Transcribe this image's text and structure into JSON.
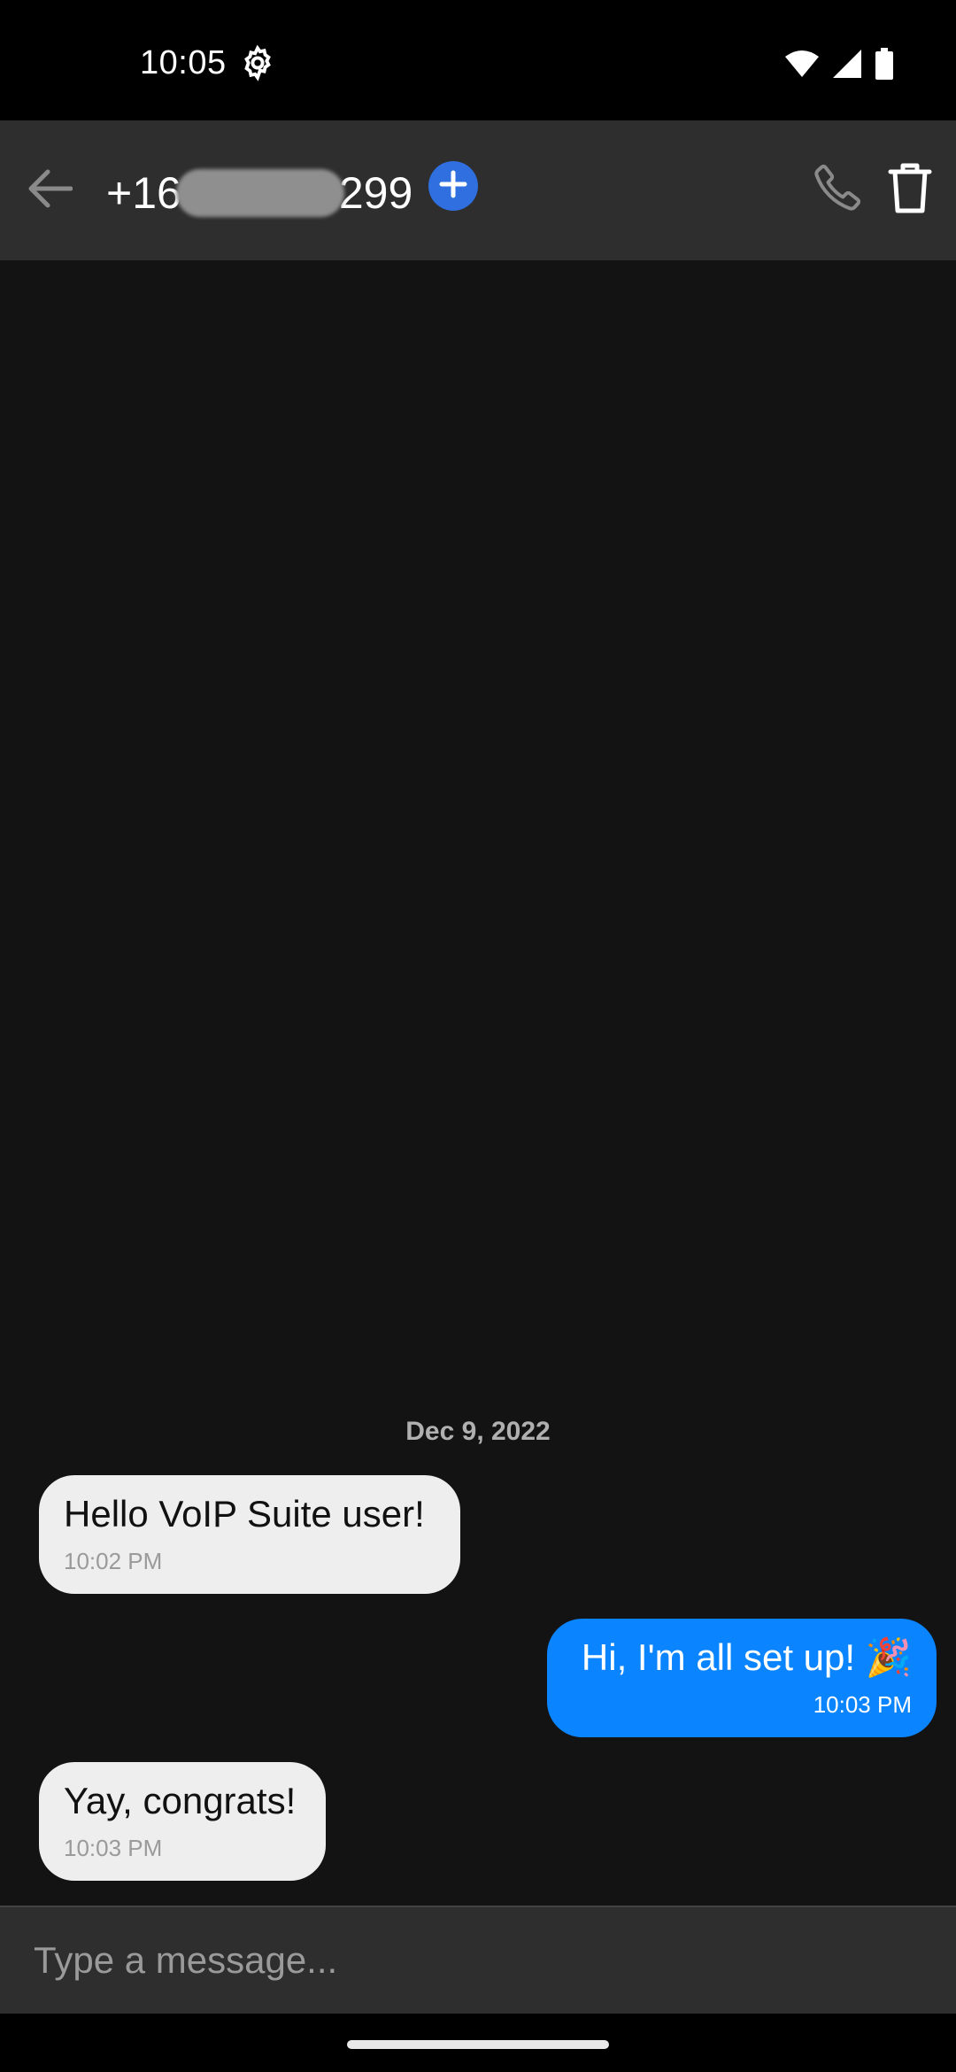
{
  "status_bar": {
    "time": "10:05",
    "icons": [
      "gear-icon",
      "wifi-icon",
      "cellular-signal-icon",
      "battery-icon"
    ]
  },
  "header": {
    "number_prefix": "+16",
    "number_suffix": "299",
    "icons": [
      "back-arrow-icon",
      "plus-icon",
      "phone-icon",
      "trash-icon"
    ]
  },
  "conversation": {
    "date_divider": "Dec 9, 2022",
    "messages": [
      {
        "direction": "incoming",
        "text": "Hello VoIP Suite user!",
        "time": "10:02 PM"
      },
      {
        "direction": "outgoing",
        "text": "Hi, I'm all set up! 🎉",
        "time": "10:03 PM"
      },
      {
        "direction": "incoming",
        "text": "Yay, congrats!",
        "time": "10:03 PM"
      }
    ]
  },
  "composer": {
    "placeholder": "Type a message..."
  },
  "colors": {
    "app_bar": "#2e2e2e",
    "background": "#131313",
    "incoming_bubble": "#eeeeee",
    "outgoing_bubble": "#0a84ff",
    "accent_button": "#2f6fe0"
  }
}
